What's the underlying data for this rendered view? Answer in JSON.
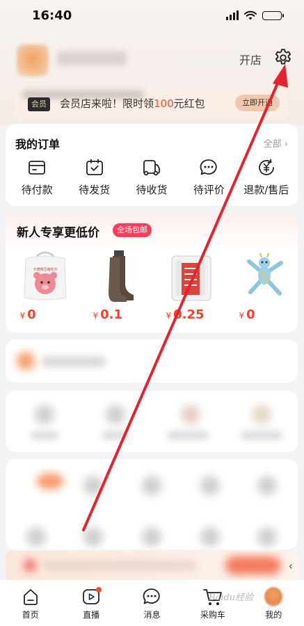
{
  "status_bar": {
    "time": "16:40"
  },
  "header": {
    "open_shop_label": "开店",
    "settings_icon": "gear-icon"
  },
  "member_banner": {
    "badge": "会员",
    "text_prefix": "会员店来啦！限时领",
    "amount": "100",
    "text_suffix": "元红包",
    "button_label": "立即开通",
    "accent_color": "#ff4a26"
  },
  "orders": {
    "title": "我的订单",
    "all_label": "全部 ›",
    "items": [
      {
        "label": "待付款",
        "icon": "wallet-icon"
      },
      {
        "label": "待发货",
        "icon": "package-check-icon"
      },
      {
        "label": "待收货",
        "icon": "truck-icon"
      },
      {
        "label": "待评价",
        "icon": "chat-bubble-icon"
      },
      {
        "label": "退款/售后",
        "icon": "refund-icon"
      }
    ]
  },
  "new_user": {
    "title": "新人专享更低价",
    "tag": "全场包邮",
    "currency": "¥",
    "products": [
      {
        "price": "0",
        "image": "face-towel-pack-image",
        "pack_text": "卡德苑压缩毛巾"
      },
      {
        "price": "0.1",
        "image": "socks-image"
      },
      {
        "price": "0.25",
        "image": "paper-roll-pack-image"
      },
      {
        "price": "0",
        "image": "giraffe-toy-image"
      }
    ],
    "price_color": "#ff3d24"
  },
  "promo_strip": {
    "collapse_icon": "chevron-left-icon"
  },
  "bottom_nav": {
    "items": [
      {
        "label": "首页",
        "icon": "home-icon"
      },
      {
        "label": "直播",
        "icon": "live-play-icon"
      },
      {
        "label": "消息",
        "icon": "message-icon"
      },
      {
        "label": "采购车",
        "icon": "cart-icon"
      },
      {
        "label": "我的",
        "icon": "avatar-icon"
      }
    ]
  },
  "watermark": "Baidu经验",
  "annotation": {
    "arrow_color": "#e8222c"
  }
}
